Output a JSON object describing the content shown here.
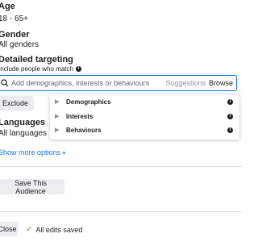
{
  "age": {
    "label": "Age",
    "value": "18 - 65+"
  },
  "gender": {
    "label": "Gender",
    "value": "All genders"
  },
  "detailed_targeting": {
    "label": "Detailed targeting",
    "hint": "Include people who match",
    "search_placeholder": "Add demographics, interests or behaviours",
    "suggestions_label": "Suggestions",
    "browse_label": "Browse",
    "exclude_label": "Exclude",
    "categories": [
      {
        "label": "Demographics"
      },
      {
        "label": "Interests"
      },
      {
        "label": "Behaviours"
      }
    ]
  },
  "languages": {
    "label": "Languages",
    "value": "All languages"
  },
  "show_more_label": "Show more options",
  "save_audience_label": "Save This Audience",
  "footer": {
    "close_label": "Close",
    "status_text": "All edits saved"
  },
  "colors": {
    "accent": "#1877f2",
    "success": "#42b72a",
    "button_bg": "#ebedf0"
  }
}
